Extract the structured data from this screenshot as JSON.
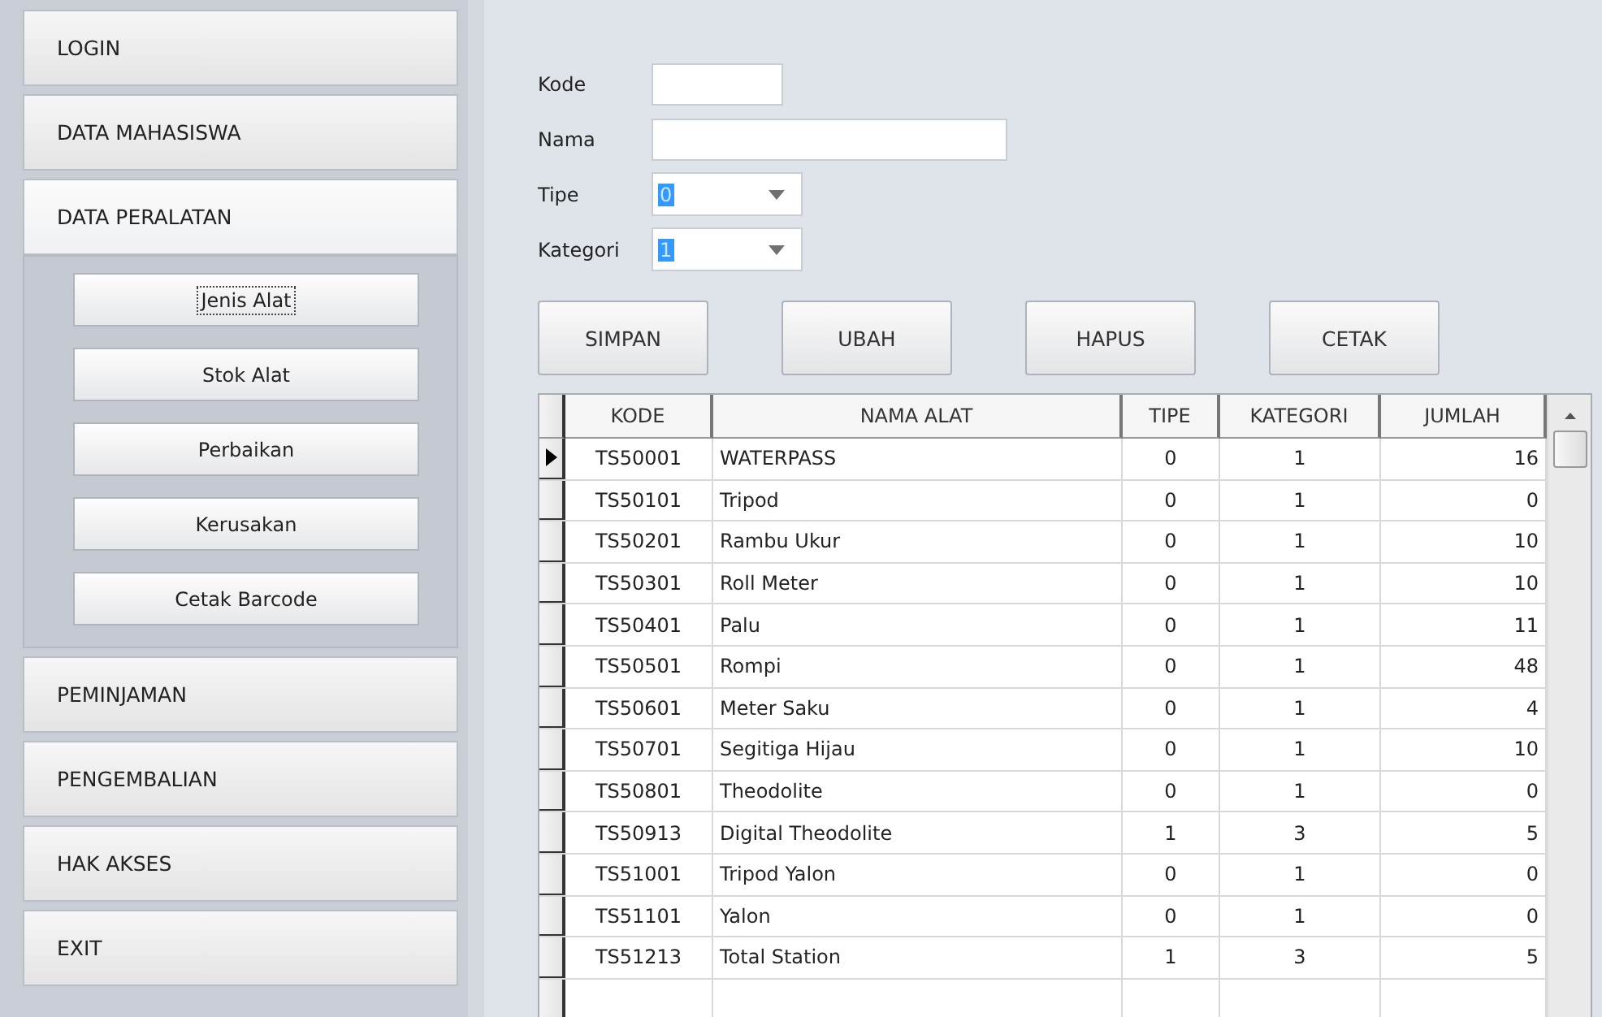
{
  "sidebar": {
    "items": [
      {
        "label": "LOGIN",
        "selected": false
      },
      {
        "label": "DATA MAHASISWA",
        "selected": false
      },
      {
        "label": "DATA PERALATAN",
        "selected": true,
        "children": [
          {
            "label": "Jenis Alat",
            "focused": true
          },
          {
            "label": "Stok Alat",
            "focused": false
          },
          {
            "label": "Perbaikan",
            "focused": false
          },
          {
            "label": "Kerusakan",
            "focused": false
          },
          {
            "label": "Cetak Barcode",
            "focused": false
          }
        ]
      },
      {
        "label": "PEMINJAMAN",
        "selected": false
      },
      {
        "label": "PENGEMBALIAN",
        "selected": false
      },
      {
        "label": "HAK AKSES",
        "selected": false
      },
      {
        "label": "EXIT",
        "selected": false
      }
    ]
  },
  "form": {
    "fields": [
      {
        "label": "Kode",
        "kind": "text"
      },
      {
        "label": "Nama",
        "kind": "text"
      },
      {
        "label": "Tipe",
        "kind": "combo",
        "value": "0"
      },
      {
        "label": "Kategori",
        "kind": "combo",
        "value": "1"
      }
    ],
    "buttons": [
      "SIMPAN",
      "UBAH",
      "HAPUS",
      "CETAK"
    ]
  },
  "table": {
    "columns": [
      "KODE",
      "NAMA ALAT",
      "TIPE",
      "KATEGORI",
      "JUMLAH"
    ],
    "rows": [
      {
        "cells": [
          "TS50001",
          "WATERPASS",
          "0",
          "1",
          "16"
        ],
        "selected": true
      },
      {
        "cells": [
          "TS50101",
          "Tripod",
          "0",
          "1",
          "0"
        ],
        "selected": false
      },
      {
        "cells": [
          "TS50201",
          "Rambu Ukur",
          "0",
          "1",
          "10"
        ],
        "selected": false
      },
      {
        "cells": [
          "TS50301",
          "Roll Meter",
          "0",
          "1",
          "10"
        ],
        "selected": false
      },
      {
        "cells": [
          "TS50401",
          "Palu",
          "0",
          "1",
          "11"
        ],
        "selected": false
      },
      {
        "cells": [
          "TS50501",
          "Rompi",
          "0",
          "1",
          "48"
        ],
        "selected": false
      },
      {
        "cells": [
          "TS50601",
          "Meter Saku",
          "0",
          "1",
          "4"
        ],
        "selected": false
      },
      {
        "cells": [
          "TS50701",
          "Segitiga Hijau",
          "0",
          "1",
          "10"
        ],
        "selected": false
      },
      {
        "cells": [
          "TS50801",
          "Theodolite",
          "0",
          "1",
          "0"
        ],
        "selected": false
      },
      {
        "cells": [
          "TS50913",
          "Digital Theodolite",
          "1",
          "3",
          "5"
        ],
        "selected": false
      },
      {
        "cells": [
          "TS51001",
          "Tripod Yalon",
          "0",
          "1",
          "0"
        ],
        "selected": false
      },
      {
        "cells": [
          "TS51101",
          "Yalon",
          "0",
          "1",
          "0"
        ],
        "selected": false
      },
      {
        "cells": [
          "TS51213",
          "Total Station",
          "1",
          "3",
          "5"
        ],
        "selected": false
      }
    ]
  }
}
